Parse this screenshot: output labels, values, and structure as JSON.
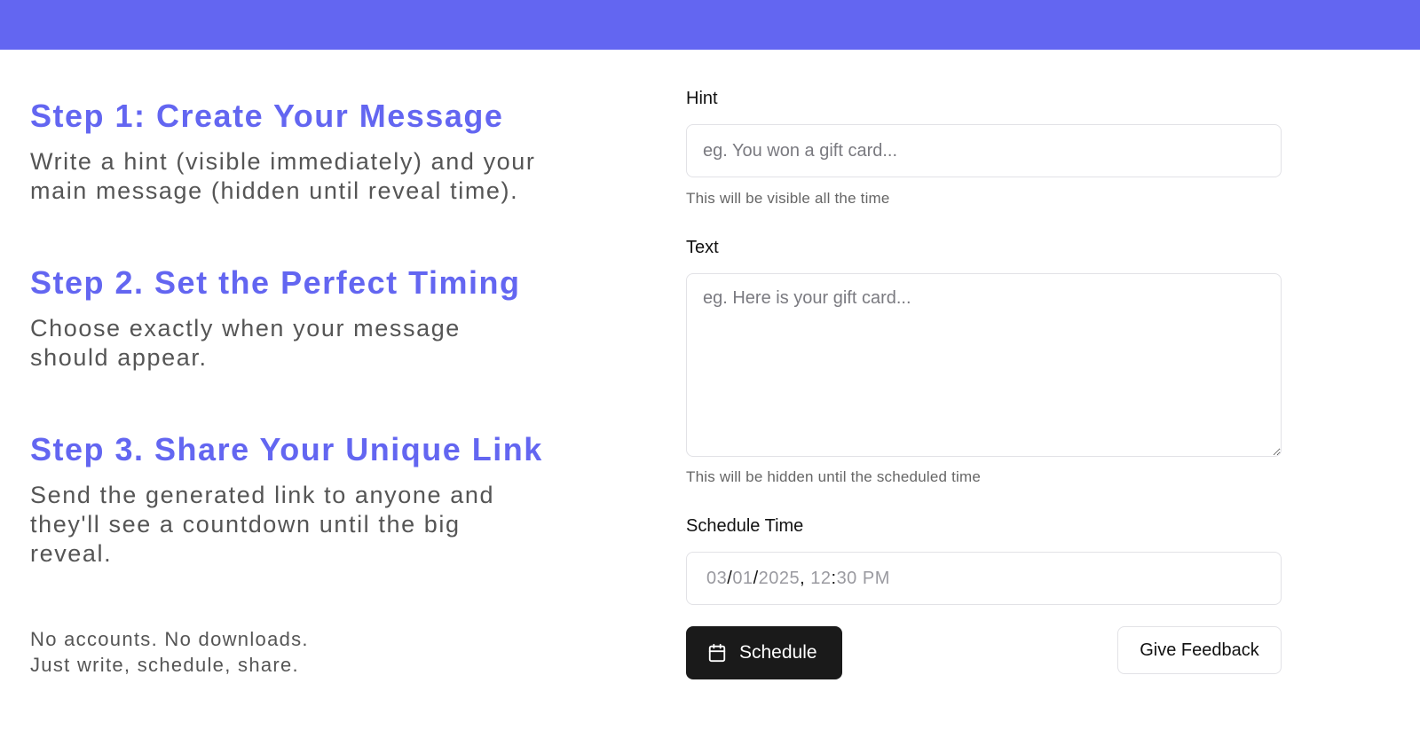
{
  "steps": [
    {
      "title": "Step 1: Create Your Message",
      "description": "Write a hint (visible immediately) and your main message (hidden until reveal time)."
    },
    {
      "title": "Step 2. Set the Perfect Timing",
      "description": "Choose exactly when your message should appear."
    },
    {
      "title": "Step 3. Share Your Unique Link",
      "description": "Send the generated link to anyone and they'll see a countdown until the big reveal."
    }
  ],
  "footer_note": {
    "line1": "No accounts. No downloads.",
    "line2": "Just write, schedule, share."
  },
  "form": {
    "hint": {
      "label": "Hint",
      "placeholder": "eg. You won a gift card...",
      "help": "This will be visible all the time"
    },
    "text": {
      "label": "Text",
      "placeholder": "eg. Here is your gift card...",
      "help": "This will be hidden until the scheduled time"
    },
    "schedule_time": {
      "label": "Schedule Time",
      "month": "03",
      "day": "01",
      "year": "2025",
      "hour": "12",
      "minute": "30",
      "ampm": "PM"
    },
    "schedule_button": "Schedule",
    "feedback_button": "Give Feedback"
  },
  "colors": {
    "accent": "#6366f1",
    "button_dark": "#1a1a1a"
  },
  "icons": {
    "schedule_button_icon": "calendar-icon"
  }
}
